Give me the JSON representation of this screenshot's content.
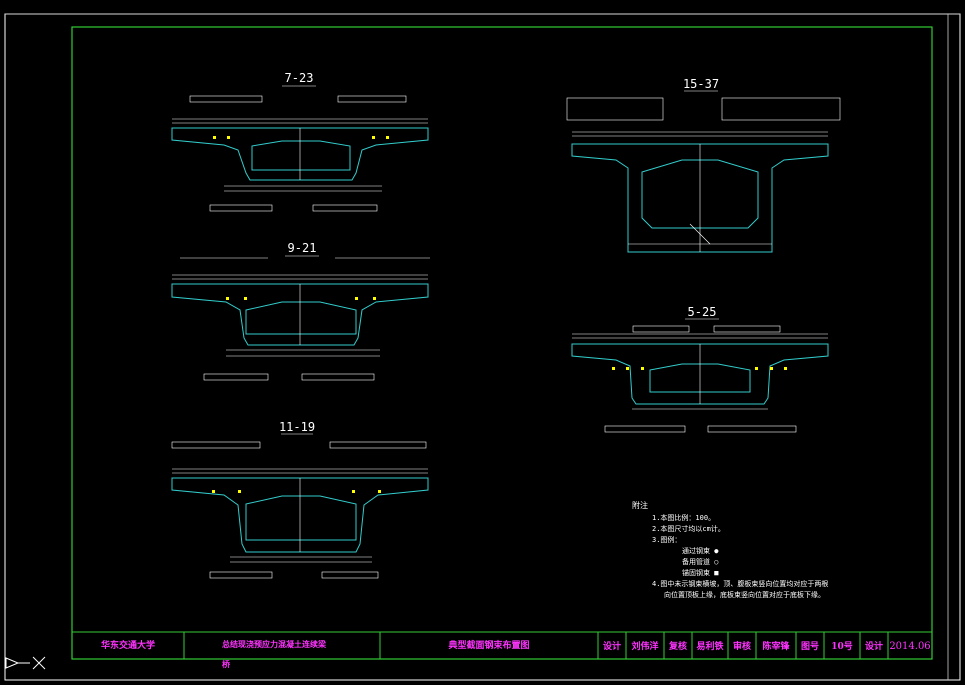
{
  "sections": [
    {
      "id": "s1",
      "label": "7-23"
    },
    {
      "id": "s2",
      "label": "9-21"
    },
    {
      "id": "s3",
      "label": "11-19"
    },
    {
      "id": "s4",
      "label": "15-37"
    },
    {
      "id": "s5",
      "label": "5-25"
    }
  ],
  "notes": {
    "heading": "附注",
    "lines": [
      "1.本图比例：100。",
      "2.本图尺寸均以cm计。",
      "3.图例：",
      "通过钢束 ●",
      "备用管道 ○",
      "锚固钢束 ■",
      "4.图中未示钢束横坡，顶、腹板束竖向位置均对应于两根",
      "向位置顶板上缘，底板束竖向位置对应于底板下缘。"
    ]
  },
  "title_block": {
    "school": "华东交通大学",
    "project_line1": "总结现浇预应力混凝土连续梁",
    "project_line2": "桥",
    "drawing_title": "典型截面钢束布置图",
    "design_label": "设计",
    "design_name": "刘伟洋",
    "review_label": "复核",
    "review_name": "易利铁",
    "audit_label": "审核",
    "audit_name": "陈宰锋",
    "drawing_no_label": "图号",
    "drawing_no": "10号",
    "date_label": "设计",
    "date": "2014.06"
  },
  "colors": {
    "border": "#33cc33",
    "section": "#33cccc",
    "dimension": "#ffffff",
    "title_text": "#ff33ff",
    "anchor": "#ffff00",
    "background": "#000000"
  }
}
